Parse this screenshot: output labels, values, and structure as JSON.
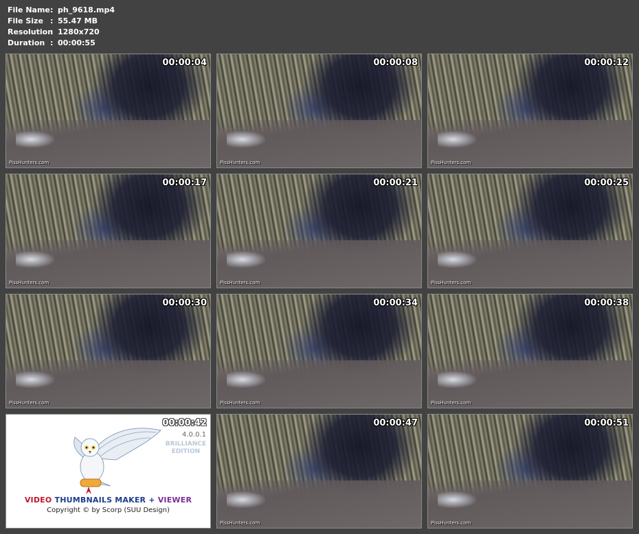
{
  "info": {
    "separator": ":",
    "rows": [
      {
        "label": "File Name",
        "value": "ph_9618.mp4"
      },
      {
        "label": "File Size",
        "value": "55.47 MB"
      },
      {
        "label": "Resolution",
        "value": "1280x720"
      },
      {
        "label": "Duration",
        "value": "00:00:55"
      }
    ]
  },
  "thumbnails": [
    {
      "timestamp": "00:00:04",
      "watermark": "PissHunters.com"
    },
    {
      "timestamp": "00:00:08",
      "watermark": "PissHunters.com"
    },
    {
      "timestamp": "00:00:12",
      "watermark": "PissHunters.com"
    },
    {
      "timestamp": "00:00:17",
      "watermark": "PissHunters.com"
    },
    {
      "timestamp": "00:00:21",
      "watermark": "PissHunters.com"
    },
    {
      "timestamp": "00:00:25",
      "watermark": "PissHunters.com"
    },
    {
      "timestamp": "00:00:30",
      "watermark": "PissHunters.com"
    },
    {
      "timestamp": "00:00:34",
      "watermark": "PissHunters.com"
    },
    {
      "timestamp": "00:00:38",
      "watermark": "PissHunters.com"
    },
    {
      "timestamp": "00:00:42"
    },
    {
      "timestamp": "00:00:47",
      "watermark": "PissHunters.com"
    },
    {
      "timestamp": "00:00:51",
      "watermark": "PissHunters.com"
    }
  ],
  "logo": {
    "version": "4.0.0.1",
    "edition_line1": "BRILLIANCE",
    "edition_line2": "EDITION",
    "product_video": "VIDEO",
    "product_thumbnails": "THUMBNAILS MAKER",
    "product_plus": "+",
    "product_viewer": "VIEWER",
    "copyright": "Copyright © by Scorp (SUU Design)",
    "icon": "owl-icon"
  },
  "colors": {
    "background": "#424242",
    "text": "#ffffff",
    "video": "#c0182a",
    "thumbnails": "#1e3c8c",
    "viewer": "#7a2d9a"
  }
}
